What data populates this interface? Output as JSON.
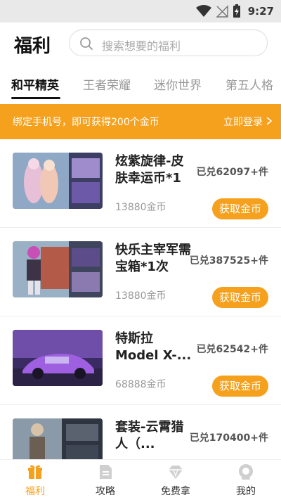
{
  "status_bar": {
    "time": "9:27"
  },
  "header": {
    "title": "福利",
    "search_placeholder": "搜索想要的福利"
  },
  "tabs": [
    {
      "label": "和平精英",
      "active": true
    },
    {
      "label": "王者荣耀",
      "active": false
    },
    {
      "label": "迷你世界",
      "active": false
    },
    {
      "label": "第五人格",
      "active": false
    }
  ],
  "banner": {
    "text": "绑定手机号，即可获得200个金币",
    "action": "立即登录"
  },
  "items": [
    {
      "title": "炫紫旋律-皮肤幸运币*1",
      "price": "13880金币",
      "count": "已兑62097+件",
      "button": "获取金币"
    },
    {
      "title": "快乐主宰军需宝箱*1次",
      "price": "13880金币",
      "count": "已兑387525+件",
      "button": "获取金币"
    },
    {
      "title": "特斯拉Model X-...",
      "price": "68888金币",
      "count": "已兑62542+件",
      "button": "获取金币"
    },
    {
      "title": "套装-云霄猎人（...",
      "price": "",
      "count": "已兑170400+件",
      "button": ""
    }
  ],
  "bottom_nav": [
    {
      "label": "福利",
      "icon": "gift-icon",
      "active": true
    },
    {
      "label": "攻略",
      "icon": "document-icon",
      "active": false
    },
    {
      "label": "免费拿",
      "icon": "diamond-icon",
      "active": false
    },
    {
      "label": "我的",
      "icon": "profile-icon",
      "active": false
    }
  ],
  "colors": {
    "accent": "#f6a11e",
    "status_bar_bg": "#e9e9e9"
  }
}
